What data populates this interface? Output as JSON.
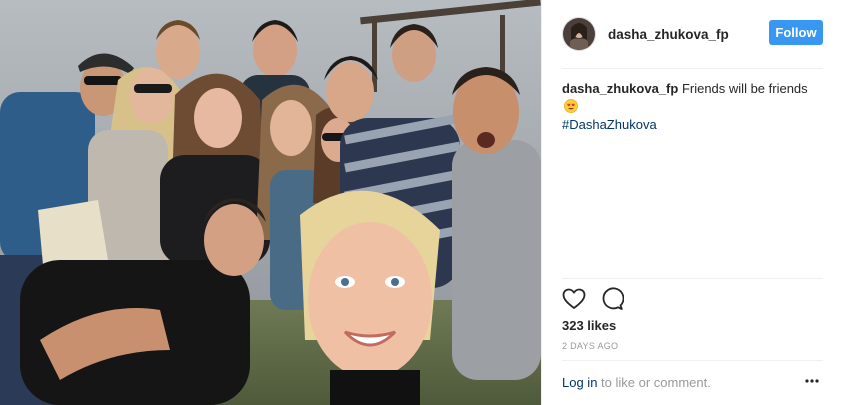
{
  "post": {
    "username": "dasha_zhukova_fp",
    "follow_label": "Follow",
    "caption": {
      "username": "dasha_zhukova_fp",
      "text": " Friends will be friends ",
      "emoji": "heart-eyes-emoji",
      "hashtag": "#DashaZhukova"
    },
    "likes": "323 likes",
    "timestamp": "2 DAYS AGO",
    "comment_prompt": {
      "login_link": "Log in",
      "rest": " to like or comment."
    }
  },
  "icons": {
    "like": "heart-icon",
    "comment": "comment-bubble-icon",
    "more": "more-options-icon"
  },
  "colors": {
    "follow_button": "#3897f0",
    "hashtag_link": "#003569",
    "muted_text": "#999999",
    "primary_text": "#262626"
  }
}
